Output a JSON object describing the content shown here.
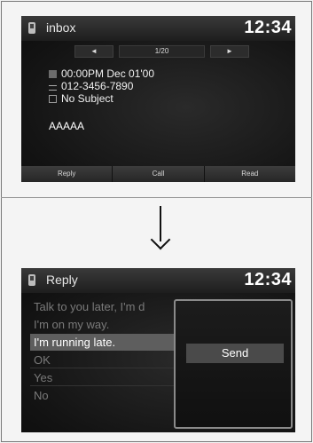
{
  "inbox_screen": {
    "title": "inbox",
    "clock": "12:34",
    "pager": {
      "prev": "◄",
      "position": "1/20",
      "next": "►"
    },
    "datetime": "00:00PM Dec 01'00",
    "phone": "012-3456-7890",
    "subject": "No Subject",
    "body": "AAAAA",
    "buttons": [
      "Reply",
      "Call",
      "Read"
    ]
  },
  "reply_screen": {
    "title": "Reply",
    "clock": "12:34",
    "options": [
      {
        "label": "Talk to you later, I'm d"
      },
      {
        "label": "I'm on my way."
      },
      {
        "label": "I'm running late."
      },
      {
        "label": "OK"
      },
      {
        "label": "Yes"
      },
      {
        "label": "No"
      }
    ],
    "selected_index": 2,
    "popup_button": "Send"
  },
  "transition_arrow": "down-arrow",
  "colors": {
    "screen_bg": "#141414",
    "selected_row": "#5e5e5e",
    "popup_border": "#8a8a8a"
  }
}
